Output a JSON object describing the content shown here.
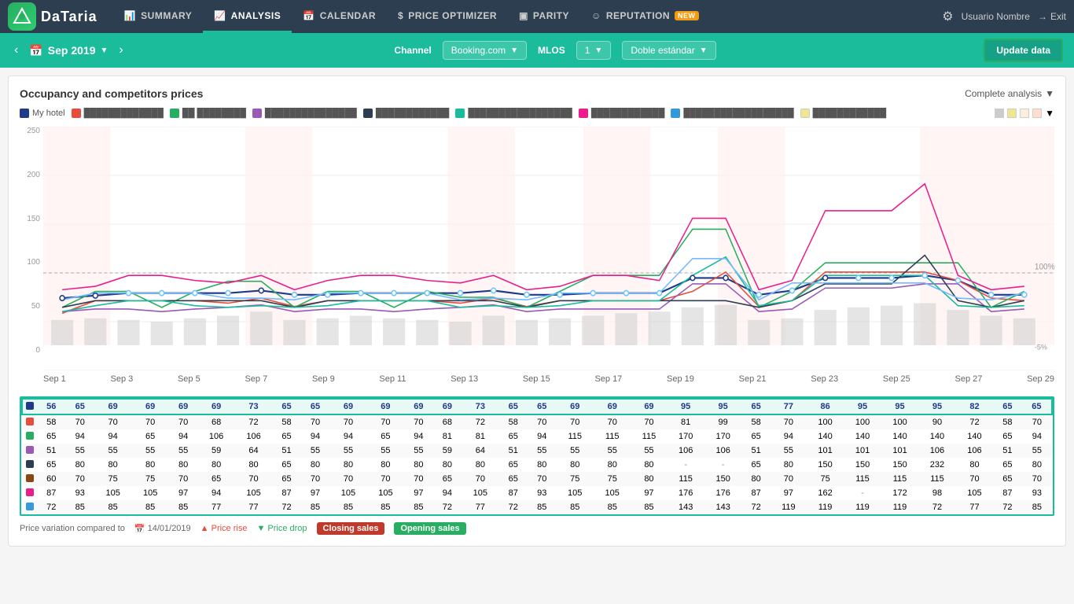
{
  "nav": {
    "logo_text": "DaTaria",
    "items": [
      {
        "id": "summary",
        "label": "SUMMARY",
        "icon": "📊",
        "active": false
      },
      {
        "id": "analysis",
        "label": "ANALYSIS",
        "icon": "📈",
        "active": true
      },
      {
        "id": "calendar",
        "label": "CALENDAR",
        "icon": "📅",
        "active": false
      },
      {
        "id": "price-optimizer",
        "label": "PRICE OPTIMIZER",
        "icon": "$",
        "active": false
      },
      {
        "id": "parity",
        "label": "PARITY",
        "icon": "▣",
        "active": false
      },
      {
        "id": "reputation",
        "label": "REPUTATION",
        "icon": "☺",
        "active": false,
        "badge": "NEW"
      }
    ],
    "settings_icon": "⚙",
    "user_name": "Usuario Nombre",
    "exit_label": "Exit"
  },
  "subnav": {
    "prev_label": "‹",
    "next_label": "›",
    "date": "Sep 2019",
    "channel_label": "Channel",
    "channel_value": "Booking.com",
    "mlos_label": "MLOS",
    "mlos_value": "1",
    "room_type": "Doble estándar",
    "update_label": "Update data"
  },
  "chart": {
    "title": "Occupancy and competitors prices",
    "complete_analysis": "Complete analysis",
    "y_labels": [
      "250",
      "200",
      "150",
      "100",
      "50",
      "0"
    ],
    "x_labels": [
      "Sep 1",
      "Sep 3",
      "Sep 5",
      "Sep 7",
      "Sep 9",
      "Sep 11",
      "Sep 13",
      "Sep 15",
      "Sep 17",
      "Sep 19",
      "Sep 21",
      "Sep 23",
      "Sep 25",
      "Sep 27",
      "Sep 29"
    ],
    "hundred_label": "100%",
    "legend": [
      {
        "color": "#1e3a8a",
        "label": "My hotel",
        "shape": "square"
      },
      {
        "color": "#e74c3c",
        "label": "Competitor 1",
        "shape": "square"
      },
      {
        "color": "#27ae60",
        "label": "Competitor 2",
        "shape": "square"
      },
      {
        "color": "#9b59b6",
        "label": "Competitor 3",
        "shape": "square"
      },
      {
        "color": "#2c3e50",
        "label": "Competitor 4",
        "shape": "square"
      },
      {
        "color": "#1abc9c",
        "label": "Competitor 5",
        "shape": "square"
      },
      {
        "color": "#e91e8c",
        "label": "Competitor 6",
        "shape": "square"
      },
      {
        "color": "#3498db",
        "label": "Competitor 7",
        "shape": "square"
      },
      {
        "color": "#f5f5dc",
        "label": "Competitor 8",
        "shape": "square"
      }
    ]
  },
  "table": {
    "rows": [
      {
        "color": "#1e3a8a",
        "values": [
          "56",
          "65",
          "69",
          "69",
          "69",
          "69",
          "73",
          "65",
          "65",
          "69",
          "69",
          "69",
          "69",
          "73",
          "65",
          "65",
          "69",
          "69",
          "69",
          "95",
          "95",
          "65",
          "77",
          "86",
          "95",
          "95",
          "95",
          "82",
          "65",
          "65"
        ]
      },
      {
        "color": "#e74c3c",
        "values": [
          "58",
          "70",
          "70",
          "70",
          "70",
          "68",
          "72",
          "58",
          "70",
          "70",
          "70",
          "70",
          "68",
          "72",
          "58",
          "70",
          "70",
          "70",
          "70",
          "81",
          "99",
          "58",
          "70",
          "100",
          "100",
          "100",
          "90",
          "72",
          "58",
          "70"
        ]
      },
      {
        "color": "#27ae60",
        "values": [
          "65",
          "94",
          "94",
          "65",
          "94",
          "106",
          "106",
          "65",
          "94",
          "94",
          "65",
          "94",
          "81",
          "81",
          "65",
          "94",
          "115",
          "115",
          "115",
          "170",
          "170",
          "65",
          "94",
          "140",
          "140",
          "140",
          "140",
          "140",
          "65",
          "94"
        ]
      },
      {
        "color": "#9b59b6",
        "values": [
          "51",
          "55",
          "55",
          "55",
          "55",
          "59",
          "64",
          "51",
          "55",
          "55",
          "55",
          "55",
          "59",
          "64",
          "51",
          "55",
          "55",
          "55",
          "55",
          "106",
          "106",
          "51",
          "55",
          "101",
          "101",
          "101",
          "106",
          "106",
          "51",
          "55"
        ]
      },
      {
        "color": "#2c3e50",
        "values": [
          "65",
          "80",
          "80",
          "80",
          "80",
          "80",
          "80",
          "65",
          "80",
          "80",
          "80",
          "80",
          "80",
          "80",
          "65",
          "80",
          "80",
          "80",
          "80",
          "-",
          "-",
          "65",
          "80",
          "150",
          "150",
          "150",
          "232",
          "80",
          "65",
          "80"
        ]
      },
      {
        "color": "#8B4513",
        "values": [
          "60",
          "70",
          "75",
          "75",
          "70",
          "65",
          "70",
          "65",
          "70",
          "70",
          "70",
          "70",
          "65",
          "70",
          "65",
          "70",
          "75",
          "75",
          "80",
          "115",
          "150",
          "80",
          "70",
          "75",
          "115",
          "115",
          "115",
          "70",
          "65",
          "70"
        ]
      },
      {
        "color": "#e91e8c",
        "values": [
          "87",
          "93",
          "105",
          "105",
          "97",
          "94",
          "105",
          "87",
          "97",
          "105",
          "105",
          "97",
          "94",
          "105",
          "87",
          "93",
          "105",
          "105",
          "97",
          "176",
          "176",
          "87",
          "97",
          "162",
          "-",
          "172",
          "98",
          "105",
          "87",
          "93"
        ]
      },
      {
        "color": "#3498db",
        "values": [
          "72",
          "85",
          "85",
          "85",
          "85",
          "77",
          "77",
          "72",
          "85",
          "85",
          "85",
          "85",
          "72",
          "77",
          "72",
          "85",
          "85",
          "85",
          "85",
          "143",
          "143",
          "72",
          "119",
          "119",
          "119",
          "119",
          "72",
          "77",
          "72",
          "85"
        ]
      }
    ]
  },
  "footer": {
    "variation_label": "Price variation compared to",
    "date_label": "14/01/2019",
    "rise_label": "▲ Price rise",
    "drop_label": "▼ Price drop",
    "closing_label": "Closing sales",
    "opening_label": "Opening sales"
  }
}
